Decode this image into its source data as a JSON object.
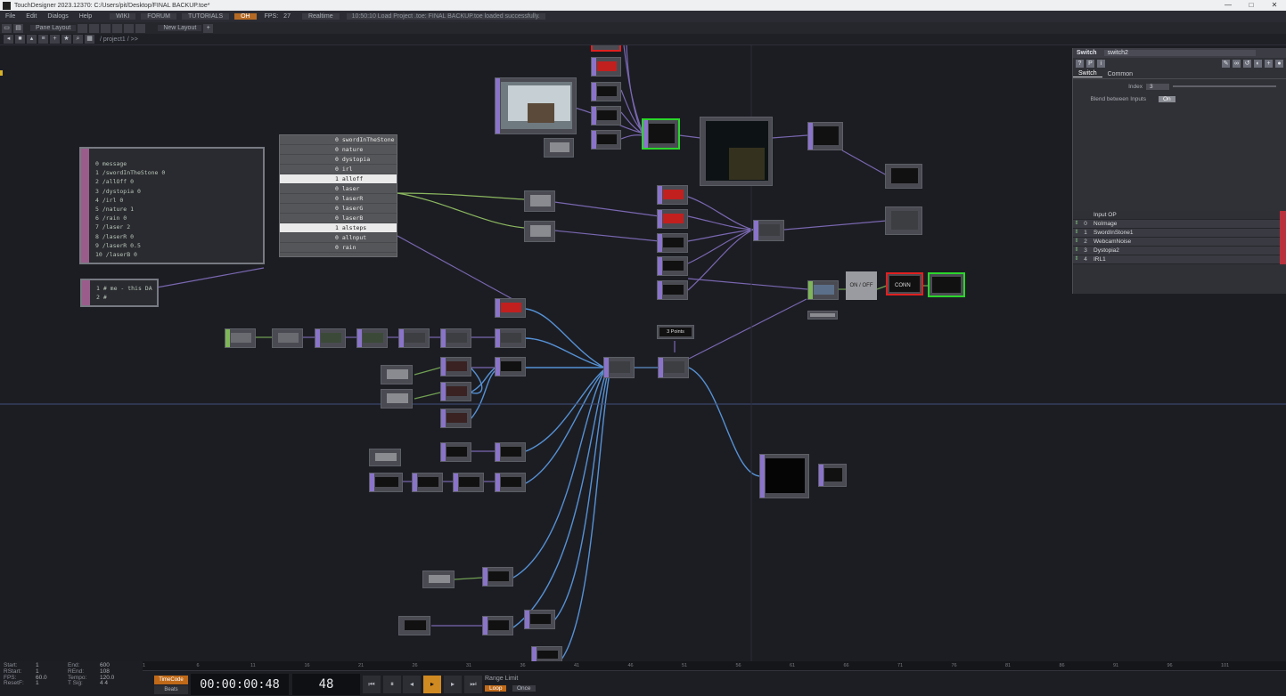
{
  "window": {
    "title": "TouchDesigner 2023.12370: C:/Users/pit/Desktop/FINAL BACKUP.toe*",
    "controls": [
      "—",
      "□",
      "✕"
    ]
  },
  "menubar": {
    "items": [
      "File",
      "Edit",
      "Dialogs",
      "Help"
    ],
    "links": [
      "WIKI",
      "FORUM",
      "TUTORIALS"
    ],
    "oh_label": "OH",
    "fps_label": "FPS:",
    "fps_value": "27",
    "realtime_label": "Realtime",
    "status_message": "10:50:10 Load Project .toe: FINAL BACKUP.toe loaded successfully."
  },
  "toolbar": {
    "pane_layout_label": "Pane Layout",
    "new_layout_label": "New Layout",
    "add_label": "+"
  },
  "pathbar": {
    "path": "/ project1 / >>"
  },
  "network": {
    "message_dat_lines": [
      "0  message",
      "1  /swordInTheStone 0",
      "2  /allOff 0",
      "3  /dystopia 0",
      "4  /irl 0",
      "5  /nature 1",
      "6  /rain 0",
      "7  /laser 2",
      "8  /laserR 0",
      "9  /laserR 0.5",
      "10 /laserB 0"
    ],
    "code_dat_lines": [
      "1  # me - this DA",
      "2  #"
    ],
    "table_rows": [
      {
        "text": "0 swordInTheStone",
        "highlight": false
      },
      {
        "text": "0 nature",
        "highlight": false
      },
      {
        "text": "0 dystopia",
        "highlight": false
      },
      {
        "text": "0 irl",
        "highlight": false
      },
      {
        "text": "1 alloff",
        "highlight": true
      },
      {
        "text": "0 laser",
        "highlight": false
      },
      {
        "text": "0 laserR",
        "highlight": false
      },
      {
        "text": "0 laserG",
        "highlight": false
      },
      {
        "text": "0 laserB",
        "highlight": false
      },
      {
        "text": "1 alsteps",
        "highlight": true
      },
      {
        "text": "0 allnput",
        "highlight": false
      },
      {
        "text": "0 rain",
        "highlight": false
      }
    ],
    "on_off_label": "ON / OFF",
    "conn_label": "CONN",
    "points_label": "3 Points"
  },
  "parameters": {
    "op_type": "Switch",
    "op_name": "switch2",
    "tabs": [
      "Switch",
      "Common"
    ],
    "index_label": "Index",
    "index_value": "3",
    "blend_label": "Blend between Inputs",
    "blend_value": "On",
    "input_header": "Input OP",
    "inputs": [
      {
        "idx": "0",
        "name": "NoImage"
      },
      {
        "idx": "1",
        "name": "SwordInStone1"
      },
      {
        "idx": "2",
        "name": "WebcamNoise"
      },
      {
        "idx": "3",
        "name": "Dystopia2"
      },
      {
        "idx": "4",
        "name": "IRL1"
      }
    ]
  },
  "timeline": {
    "stats": [
      {
        "k": "Start:",
        "v": "1",
        "k2": "End:",
        "v2": "600"
      },
      {
        "k": "RStart:",
        "v": "1",
        "k2": "REnd:",
        "v2": "108"
      },
      {
        "k": "FPS:",
        "v": "60.0",
        "k2": "Tempo:",
        "v2": "120.0"
      },
      {
        "k": "ResetF:",
        "v": "1",
        "k2": "T Sig:",
        "v2": "4    4"
      }
    ],
    "ruler_ticks": [
      "1",
      "6",
      "11",
      "16",
      "21",
      "26",
      "31",
      "36",
      "41",
      "46",
      "51",
      "56",
      "61",
      "66",
      "71",
      "76",
      "81",
      "86",
      "91",
      "96",
      "101"
    ],
    "timecode_label": "TimeCode",
    "beats_label": "Beats",
    "timecode": "00:00:00:48",
    "frame": "48",
    "range_limit_label": "Range Limit",
    "loop_label": "Loop",
    "once_label": "Once"
  }
}
